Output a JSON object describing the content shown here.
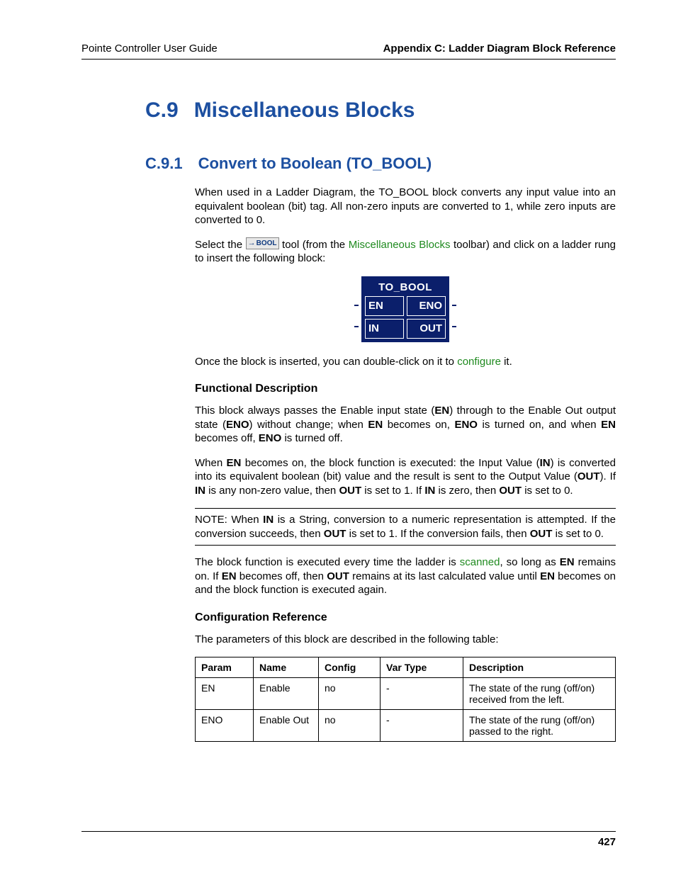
{
  "header": {
    "left": "Pointe Controller User Guide",
    "right": "Appendix C: Ladder Diagram Block Reference"
  },
  "h1": {
    "num": "C.9",
    "title": "Miscellaneous Blocks"
  },
  "h2": {
    "num": "C.9.1",
    "title": "Convert to Boolean (TO_BOOL)"
  },
  "intro": "When used in a Ladder Diagram, the TO_BOOL block converts any input value into an equivalent boolean (bit) tag. All non-zero inputs are converted to 1, while zero inputs are converted to 0.",
  "select": {
    "pre": "Select the ",
    "icon_label": "BOOL",
    "mid": " tool (from the ",
    "link": "Miscellaneous Blocks",
    "post": " toolbar) and click on a ladder rung to insert the following block:"
  },
  "block": {
    "title": "TO_BOOL",
    "en": "EN",
    "eno": "ENO",
    "in": "IN",
    "out": "OUT"
  },
  "after_diagram": {
    "pre": "Once the block is inserted, you can double-click on it to ",
    "link": "configure",
    "post": " it."
  },
  "fd_heading": "Functional Description",
  "fd": {
    "p1_a": "This block always passes the Enable input state (",
    "p1_en": "EN",
    "p1_b": ") through to the Enable Out output state (",
    "p1_eno": "ENO",
    "p1_c": ") without change; when ",
    "p1_en2": "EN",
    "p1_d": " becomes on, ",
    "p1_eno2": "ENO",
    "p1_e": " is turned on, and when ",
    "p1_en3": "EN",
    "p1_f": " becomes off, ",
    "p1_eno3": "ENO",
    "p1_g": " is turned off.",
    "p2_a": "When ",
    "p2_en": "EN",
    "p2_b": " becomes on, the block function is executed: the Input Value (",
    "p2_in": "IN",
    "p2_c": ") is converted into its equivalent boolean (bit) value and the result is sent to the Output Value (",
    "p2_out": "OUT",
    "p2_d": "). If ",
    "p2_in2": "IN",
    "p2_e": " is any non-zero value, then ",
    "p2_out2": "OUT",
    "p2_f": " is set to 1. If ",
    "p2_in3": "IN",
    "p2_g": " is zero, then ",
    "p2_out3": "OUT",
    "p2_h": " is set to 0."
  },
  "note": {
    "a": "NOTE: When ",
    "in": "IN",
    "b": " is a String, conversion to a numeric representation is attempted. If the conversion succeeds, then ",
    "out": "OUT",
    "c": " is set to 1. If the conversion fails, then ",
    "out2": "OUT",
    "d": " is set to 0."
  },
  "scan": {
    "a": "The block function is executed every time the ladder is ",
    "link": "scanned",
    "b": ", so long as ",
    "en": "EN",
    "c": " remains on. If ",
    "en2": "EN",
    "d": " becomes off, then ",
    "out": "OUT",
    "e": " remains at its last calculated value until ",
    "en3": "EN",
    "f": " becomes on and the block function is executed again."
  },
  "cr_heading": "Configuration Reference",
  "cr_intro": "The parameters of this block are described in the following table:",
  "table": {
    "headers": {
      "param": "Param",
      "name": "Name",
      "config": "Config",
      "vtype": "Var Type",
      "desc": "Description"
    },
    "rows": [
      {
        "param": "EN",
        "name": "Enable",
        "config": "no",
        "vtype": "-",
        "desc": "The state of the rung (off/on) received from the left."
      },
      {
        "param": "ENO",
        "name": "Enable Out",
        "config": "no",
        "vtype": "-",
        "desc": "The state of the rung (off/on) passed to the right."
      }
    ]
  },
  "page_number": "427"
}
